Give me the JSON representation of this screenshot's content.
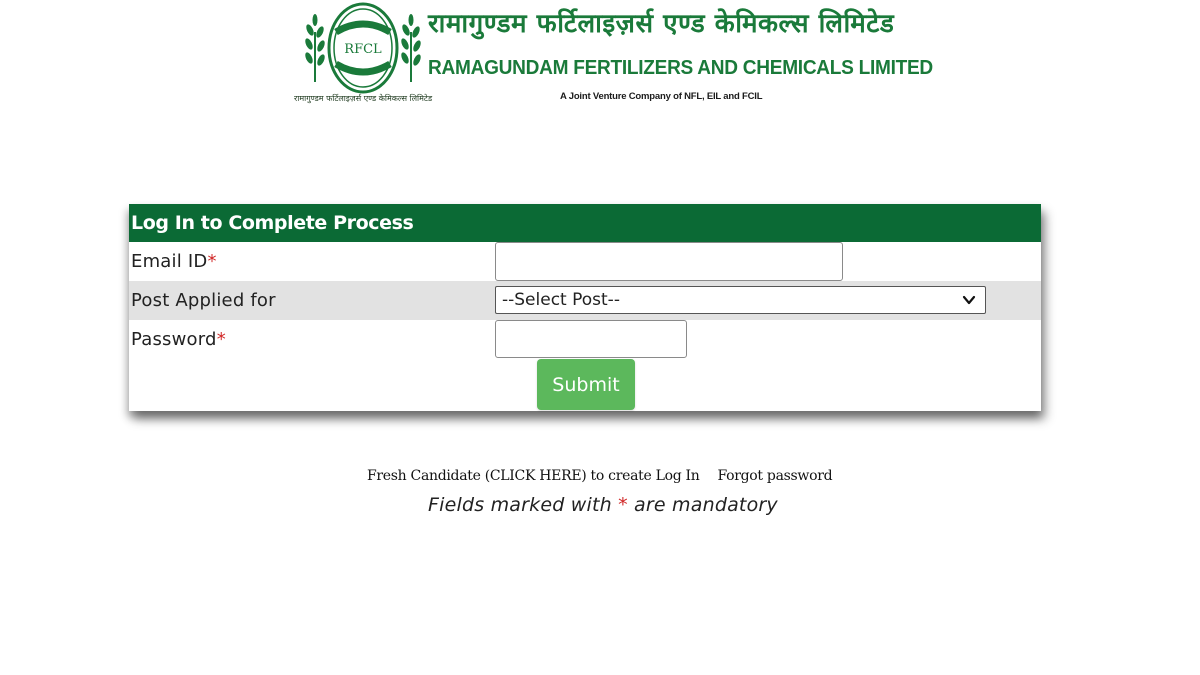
{
  "header": {
    "logo_text": "RFCL",
    "hindi_name": "रामागुण्डम फर्टिलाइज़र्स एण्ड केमिकल्स लिमिटेड",
    "english_name": "RAMAGUNDAM FERTILIZERS AND CHEMICALS LIMITED",
    "emblem_caption": "रामागुण्डम फर्टिलाइज़र्स एण्ड केमिकल्स लिमिटेड",
    "joint_venture": "A Joint Venture Company of NFL, EIL and FCIL",
    "brand_color": "#1a7a3a"
  },
  "login": {
    "heading": "Log In to Complete Process",
    "header_color": "#0b6a35",
    "email": {
      "label": "Email ID",
      "required_mark": "*",
      "value": "",
      "placeholder": ""
    },
    "post": {
      "label": "Post Applied for",
      "selected": "--Select Post--",
      "icon": "chevron-down-icon"
    },
    "password": {
      "label": "Password",
      "required_mark": "*",
      "value": "",
      "placeholder": ""
    },
    "submit_label": "Submit",
    "submit_color": "#5cb85c"
  },
  "footer": {
    "fresh_candidate_link": "Fresh Candidate (CLICK HERE) to create Log In",
    "forgot_password_link": "Forgot password",
    "mandatory_prefix": "Fields marked with",
    "mandatory_mark": "*",
    "mandatory_suffix": "are mandatory",
    "required_color": "#d12828"
  }
}
